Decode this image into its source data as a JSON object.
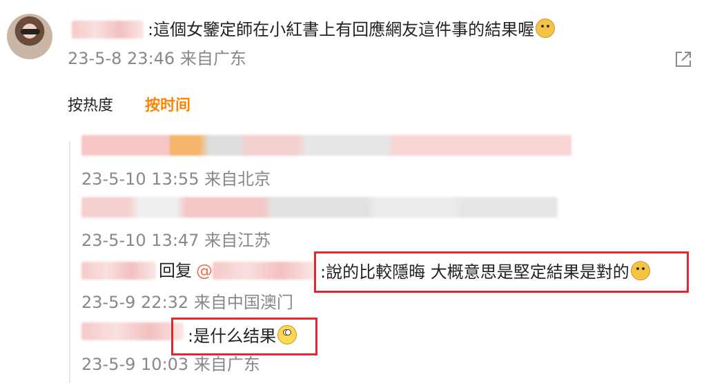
{
  "post": {
    "text": ":這個女鑒定師在小紅書上有回應網友這件事的結果喔",
    "time": "23-5-8 23:46 来自广东"
  },
  "tabs": {
    "hot": "按热度",
    "time": "按时间"
  },
  "replies": [
    {
      "time": "23-5-10 13:55 来自北京"
    },
    {
      "time": "23-5-10 13:47 来自江苏"
    },
    {
      "reply_label": "回复",
      "mention_at": "@",
      "text": ":說的比較隱晦 大概意思是堅定結果是對的",
      "time": "23-5-9 22:32 来自中国澳门"
    },
    {
      "text": ":是什么结果",
      "time": "23-5-9 10:03 来自广东"
    }
  ],
  "icons": {
    "share": "share-icon",
    "emoji_doge": "doge-emoji-icon",
    "emoji_shock": "shocked-emoji-icon"
  },
  "colors": {
    "active_tab": "#ff8200",
    "highlight_box": "#e0272d",
    "mention": "#eb7350",
    "meta": "#888888"
  }
}
